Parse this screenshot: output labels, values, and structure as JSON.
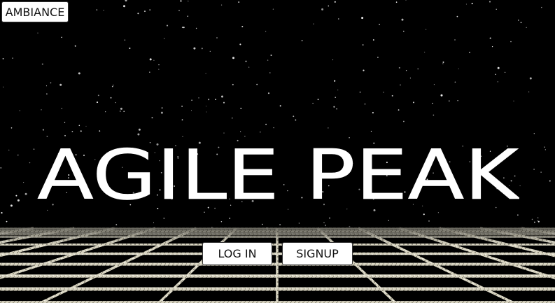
{
  "header": {
    "ambiance_label": "AMBIANCE"
  },
  "hero": {
    "title": "AGILE PEAK"
  },
  "auth": {
    "login_label": "LOG IN",
    "signup_label": "SIGNUP"
  },
  "colors": {
    "background": "#000000",
    "grid": "#e8e4d2",
    "stars": "#ffffff",
    "button_bg": "#ffffff"
  }
}
